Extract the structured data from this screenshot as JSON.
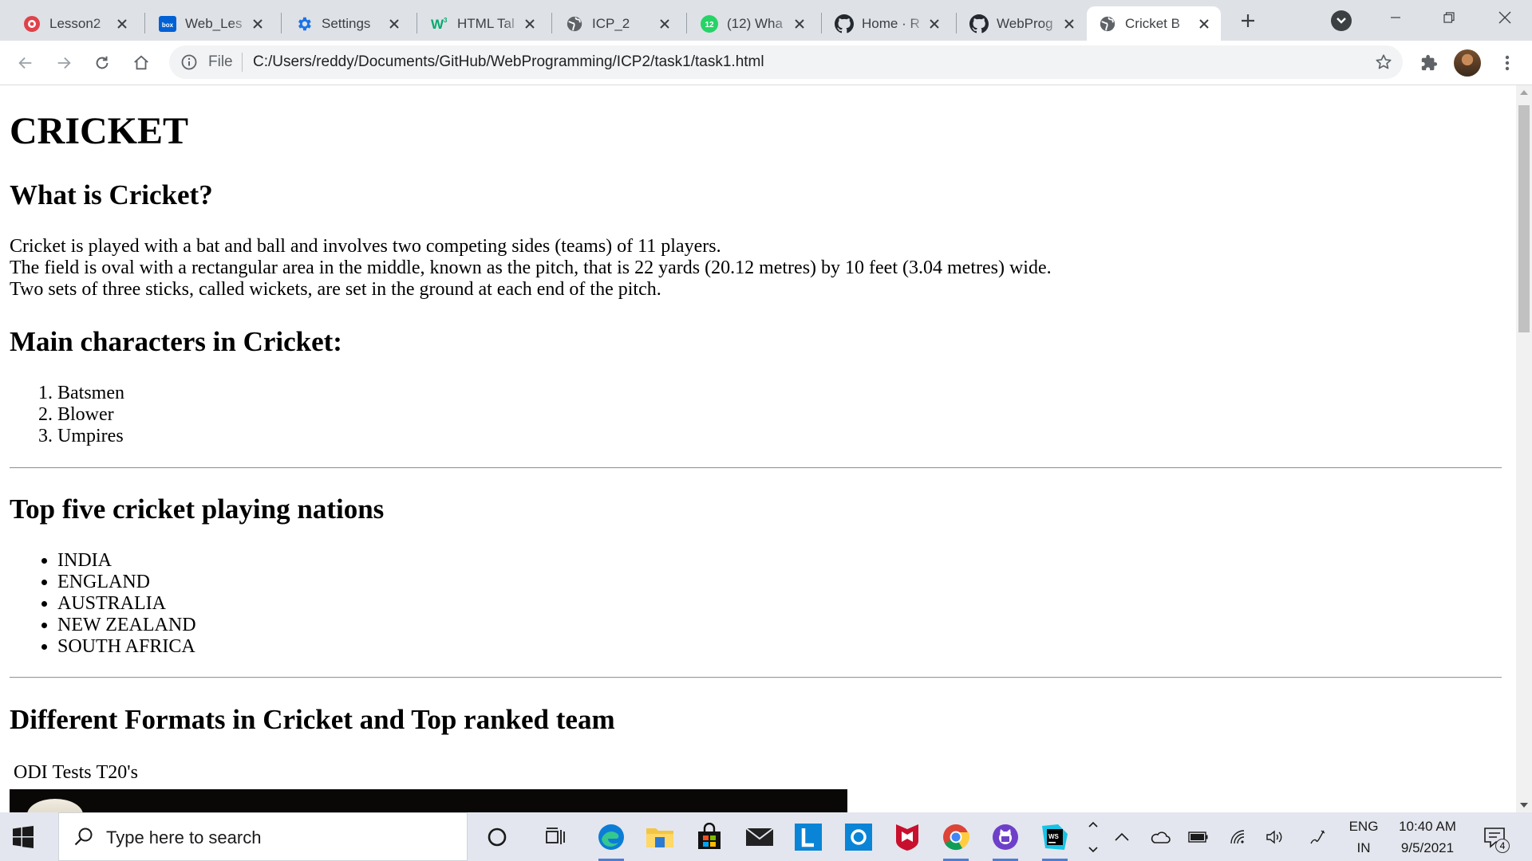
{
  "browser": {
    "tabs": [
      {
        "title": "Lesson2",
        "icon": "lesson-icon"
      },
      {
        "title": "Web_Les",
        "icon": "box-icon"
      },
      {
        "title": "Settings",
        "icon": "gear-icon"
      },
      {
        "title": "HTML Tal",
        "icon": "w3schools-icon"
      },
      {
        "title": "ICP_2",
        "icon": "globe-icon"
      },
      {
        "title": "(12) Wha",
        "icon": "whatsapp-icon",
        "badge": "12"
      },
      {
        "title": "Home · R",
        "icon": "github-icon"
      },
      {
        "title": "WebProg",
        "icon": "github-icon"
      },
      {
        "title": "Cricket B",
        "icon": "globe-icon",
        "active": true
      }
    ],
    "address": {
      "scheme_label": "File",
      "url": "C:/Users/reddy/Documents/GitHub/WebProgramming/ICP2/task1/task1.html"
    }
  },
  "page": {
    "title": "CRICKET",
    "section1": {
      "heading": "What is Cricket?",
      "lines": [
        "Cricket is played with a bat and ball and involves two competing sides (teams) of 11 players.",
        "The field is oval with a rectangular area in the middle, known as the pitch, that is 22 yards (20.12 metres) by 10 feet (3.04 metres) wide.",
        "Two sets of three sticks, called wickets, are set in the ground at each end of the pitch."
      ]
    },
    "section2": {
      "heading": "Main characters in Cricket:",
      "items": [
        "Batsmen",
        "Blower",
        "Umpires"
      ]
    },
    "section3": {
      "heading": "Top five cricket playing nations",
      "items": [
        "INDIA",
        "ENGLAND",
        "AUSTRALIA",
        "NEW ZEALAND",
        "SOUTH AFRICA"
      ]
    },
    "section4": {
      "heading": "Different Formats in Cricket and Top ranked team",
      "formats": [
        "ODI",
        "Tests",
        "T20's"
      ]
    }
  },
  "taskbar": {
    "search_placeholder": "Type here to search",
    "language": "ENG",
    "region": "IN",
    "time": "10:40 AM",
    "date": "9/5/2021",
    "notification_count": "4"
  },
  "colors": {
    "tabstrip": "#dee1e6",
    "omnibox": "#f1f3f4",
    "taskbar": "#e3e6ee"
  }
}
